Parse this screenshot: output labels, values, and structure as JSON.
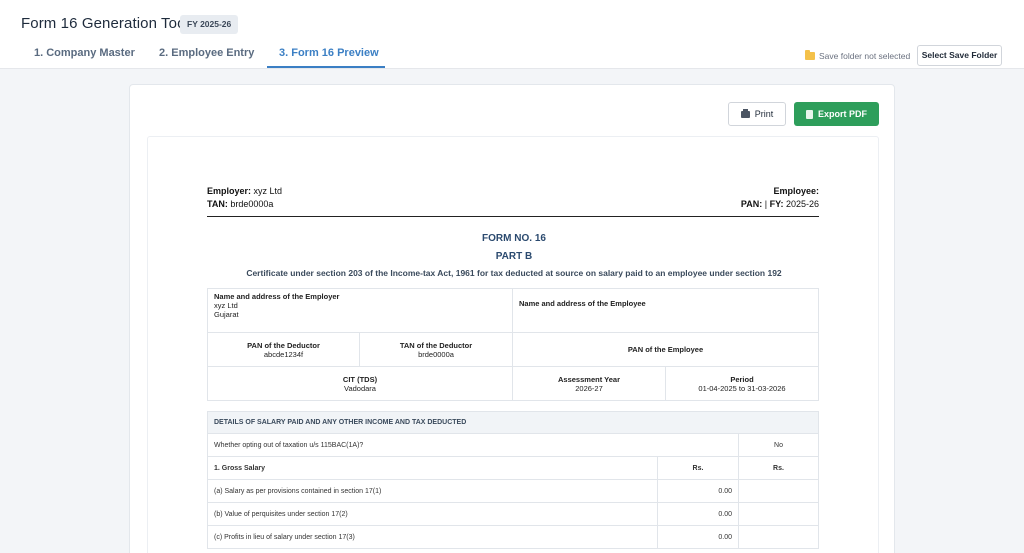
{
  "app": {
    "title": "Form 16 Generation Tool",
    "fy_badge": "FY 2025-26"
  },
  "tabs": [
    {
      "label": "1. Company Master",
      "active": false
    },
    {
      "label": "2. Employee Entry",
      "active": false
    },
    {
      "label": "3. Form 16 Preview",
      "active": true
    }
  ],
  "save": {
    "status": "Save folder not selected",
    "button": "Select Save Folder"
  },
  "actions": {
    "print": "Print",
    "export": "Export PDF"
  },
  "header": {
    "employer_label": "Employer:",
    "employer_value": "xyz Ltd",
    "tan_label": "TAN:",
    "tan_value": "brde0000a",
    "employee_label": "Employee:",
    "pan_label": "PAN:",
    "sep": "|",
    "fy_label": "FY:",
    "fy_value": "2025-26"
  },
  "form": {
    "form_no": "FORM NO. 16",
    "part": "PART B",
    "certificate": "Certificate under section 203 of the Income-tax Act, 1961 for tax deducted at source on salary paid to an employee under section 192"
  },
  "info": {
    "employer_addr_label": "Name and address of the Employer",
    "employer_name": "xyz Ltd",
    "employer_state": "Gujarat",
    "employee_addr_label": "Name and address of the Employee",
    "pan_deductor_label": "PAN of the Deductor",
    "pan_deductor": "abcde1234f",
    "tan_deductor_label": "TAN of the Deductor",
    "tan_deductor": "brde0000a",
    "pan_employee_label": "PAN of the Employee",
    "cit_label": "CIT (TDS)",
    "cit_value": "Vadodara",
    "ay_label": "Assessment Year",
    "ay_value": "2026-27",
    "period_label": "Period",
    "period_value": "01-04-2025 to 31-03-2026"
  },
  "salary": {
    "section_title": "DETAILS OF SALARY PAID AND ANY OTHER INCOME AND TAX DEDUCTED",
    "opt_out_label": "Whether opting out of taxation u/s 115BAC(1A)?",
    "opt_out_value": "No",
    "gross_label": "1. Gross Salary",
    "col_rs1": "Rs.",
    "col_rs2": "Rs.",
    "rows": [
      {
        "label": "(a) Salary as per provisions contained in section 17(1)",
        "value": "0.00"
      },
      {
        "label": "(b) Value of perquisites under section 17(2)",
        "value": "0.00"
      },
      {
        "label": "(c) Profits in lieu of salary under section 17(3)",
        "value": "0.00"
      }
    ]
  }
}
